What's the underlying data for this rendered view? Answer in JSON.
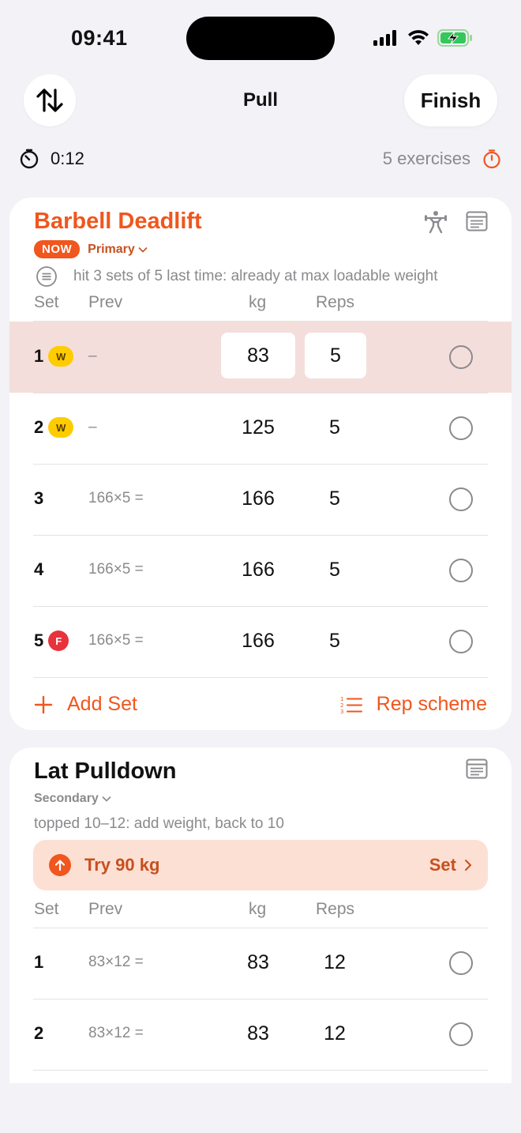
{
  "status": {
    "time": "09:41"
  },
  "nav": {
    "title": "Pull",
    "finish_label": "Finish"
  },
  "timer": {
    "elapsed": "0:12",
    "exercise_count": "5 exercises"
  },
  "exercise1": {
    "name": "Barbell Deadlift",
    "now_label": "NOW",
    "tier": "Primary",
    "note": "hit 3 sets of 5 last time: already at max loadable weight",
    "headers": {
      "set": "Set",
      "prev": "Prev",
      "kg": "kg",
      "reps": "Reps"
    },
    "sets": [
      {
        "num": "1",
        "badge": "W",
        "prev": "–",
        "kg": "83",
        "reps": "5",
        "active": true
      },
      {
        "num": "2",
        "badge": "W",
        "prev": "–",
        "kg": "125",
        "reps": "5"
      },
      {
        "num": "3",
        "badge": "",
        "prev": "166×5 =",
        "kg": "166",
        "reps": "5"
      },
      {
        "num": "4",
        "badge": "",
        "prev": "166×5 =",
        "kg": "166",
        "reps": "5"
      },
      {
        "num": "5",
        "badge": "F",
        "prev": "166×5 =",
        "kg": "166",
        "reps": "5"
      }
    ],
    "add_set_label": "Add Set",
    "rep_scheme_label": "Rep scheme"
  },
  "exercise2": {
    "name": "Lat Pulldown",
    "tier": "Secondary",
    "note": "topped 10–12: add weight, back to 10",
    "suggestion": "Try 90 kg",
    "suggestion_action": "Set",
    "headers": {
      "set": "Set",
      "prev": "Prev",
      "kg": "kg",
      "reps": "Reps"
    },
    "sets": [
      {
        "num": "1",
        "prev": "83×12 =",
        "kg": "83",
        "reps": "12"
      },
      {
        "num": "2",
        "prev": "83×12 =",
        "kg": "83",
        "reps": "12"
      }
    ]
  },
  "colors": {
    "accent": "#f0561d",
    "active_row": "#f4dedb",
    "warmup_badge": "#ffcc00",
    "failure_badge": "#e8323c",
    "suggestion_bg": "#fde0d4"
  },
  "icons": [
    "signal-icon",
    "wifi-icon",
    "battery-charging-icon",
    "reorder-icon",
    "stopwatch-icon",
    "rest-timer-icon",
    "weightlifter-icon",
    "notes-icon",
    "list-circle-icon",
    "chevron-down-icon",
    "plus-icon",
    "numbered-list-icon",
    "arrow-up-icon",
    "chevron-right-icon"
  ]
}
